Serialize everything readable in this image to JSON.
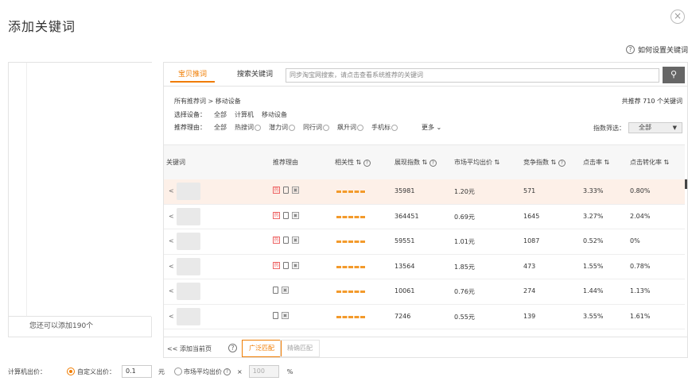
{
  "dialog": {
    "title": "添加关键词",
    "close_glyph": "×",
    "help_text": "如何设置关键词"
  },
  "left": {
    "footer": "您还可以添加190个"
  },
  "tabs": [
    {
      "label": "宝贝推词",
      "active": true
    },
    {
      "label": "搜索关键词",
      "active": false
    }
  ],
  "search": {
    "placeholder": "同步淘宝网搜索，请点击查看系统推荐的关键词"
  },
  "filter": {
    "breadcrumb": "所有推荐词 > 移动设备",
    "device_label": "选择设备：",
    "devices": [
      "全部",
      "计算机",
      "移动设备"
    ],
    "reason_label": "推荐理由：",
    "reasons": [
      "全部",
      "热搜词",
      "潜力词",
      "同行词",
      "飙升词",
      "手机标"
    ],
    "more": "更多",
    "total": "共推荐 710 个关键词",
    "index_filter_label": "指数筛选：",
    "index_filter_value": "全部"
  },
  "table": {
    "headers": {
      "keyword": "关键词",
      "reason": "推荐理由",
      "relevance": "相关性",
      "impressions": "展现指数",
      "avg_bid": "市场平均出价",
      "competition": "竞争指数",
      "ctr": "点击率",
      "cvr": "点击转化率"
    },
    "rows": [
      {
        "lt": "<",
        "hot": true,
        "impressions": "35981",
        "avg_bid": "1.20元",
        "competition": "571",
        "ctr": "3.33%",
        "cvr": "0.80%",
        "highlight": true
      },
      {
        "lt": "<",
        "hot": true,
        "impressions": "364451",
        "avg_bid": "0.69元",
        "competition": "1645",
        "ctr": "3.27%",
        "cvr": "2.04%",
        "highlight": false
      },
      {
        "lt": "<",
        "hot": true,
        "impressions": "59551",
        "avg_bid": "1.01元",
        "competition": "1087",
        "ctr": "0.52%",
        "cvr": "0%",
        "highlight": false
      },
      {
        "lt": "<",
        "hot": true,
        "impressions": "13564",
        "avg_bid": "1.85元",
        "competition": "473",
        "ctr": "1.55%",
        "cvr": "0.78%",
        "highlight": false
      },
      {
        "lt": "<",
        "hot": false,
        "impressions": "10061",
        "avg_bid": "0.76元",
        "competition": "274",
        "ctr": "1.44%",
        "cvr": "1.13%",
        "highlight": false
      },
      {
        "lt": "<",
        "hot": false,
        "impressions": "7246",
        "avg_bid": "0.55元",
        "competition": "139",
        "ctr": "3.55%",
        "cvr": "1.61%",
        "highlight": false
      }
    ]
  },
  "bottom": {
    "add_page": "<< 添加当前页",
    "broad": "广泛匹配",
    "exact": "精确匹配"
  },
  "price": {
    "label": "计算机出价：",
    "custom_label": "自定义出价：",
    "custom_value": "0.1",
    "unit": "元",
    "market_label": "市场平均出价",
    "times": "×",
    "percent_value": "100",
    "percent": "%"
  },
  "colors": {
    "accent": "#f07c00",
    "highlight_row": "#fdf0e8",
    "relevance_bar": "#f39a2b"
  }
}
